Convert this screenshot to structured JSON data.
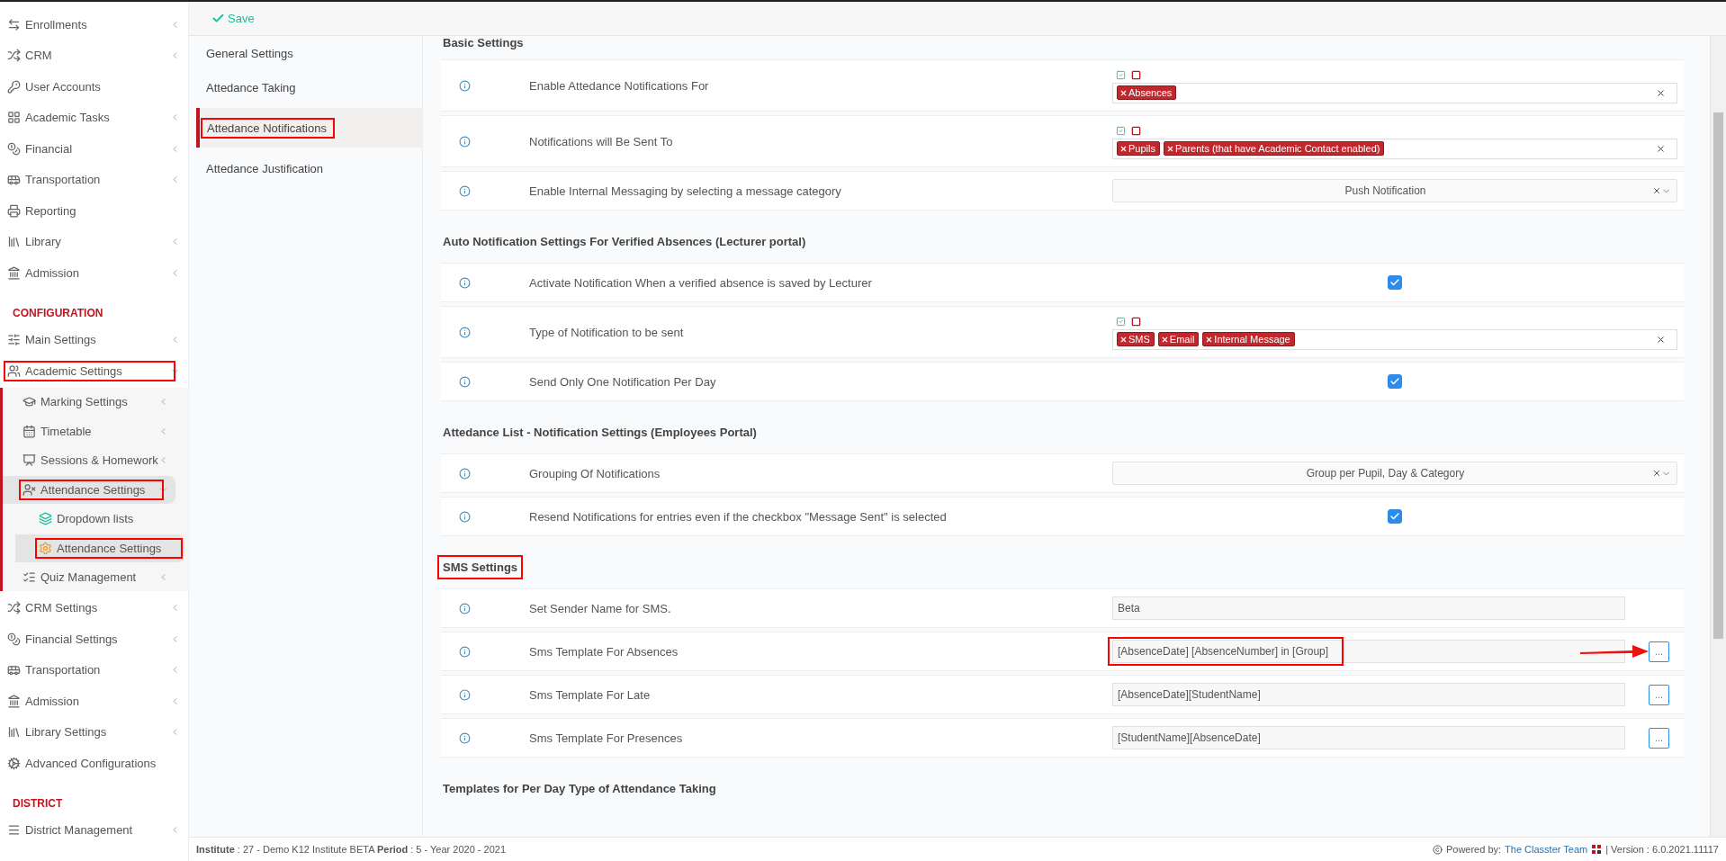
{
  "header": {
    "save_label": "Save"
  },
  "sidebar": {
    "groups": [
      {
        "items": [
          {
            "label": "Enrollments",
            "selected": false,
            "annotated": false,
            "expanded": false
          },
          {
            "label": "CRM",
            "selected": false,
            "annotated": false,
            "expanded": false
          },
          {
            "label": "User Accounts",
            "selected": false,
            "annotated": false
          },
          {
            "label": "Academic Tasks",
            "selected": false,
            "annotated": false,
            "expanded": false
          },
          {
            "label": "Financial",
            "selected": false,
            "annotated": false,
            "expanded": false
          },
          {
            "label": "Transportation",
            "selected": false,
            "annotated": false,
            "expanded": false
          },
          {
            "label": "Reporting",
            "selected": false,
            "annotated": false
          },
          {
            "label": "Library",
            "selected": false,
            "annotated": false,
            "expanded": false
          },
          {
            "label": "Admission",
            "selected": false,
            "annotated": false,
            "expanded": false
          }
        ]
      },
      {
        "heading": "CONFIGURATION",
        "items": [
          {
            "label": "Main Settings",
            "selected": false,
            "annotated": false,
            "expanded": false
          },
          {
            "label": "Academic Settings",
            "selected": false,
            "annotated": true,
            "expanded": true,
            "children": [
              {
                "label": "Marking Settings",
                "selected": false,
                "annotated": false,
                "expanded": false
              },
              {
                "label": "Timetable",
                "selected": false,
                "annotated": false,
                "expanded": false
              },
              {
                "label": "Sessions & Homework",
                "selected": false,
                "annotated": false,
                "expanded": false
              },
              {
                "label": "Attendance Settings",
                "selected": true,
                "annotated": true,
                "expanded": true,
                "children": [
                  {
                    "label": "Dropdown lists",
                    "selected": false,
                    "annotated": false
                  },
                  {
                    "label": "Attendance Settings",
                    "selected": true,
                    "annotated": true
                  }
                ]
              },
              {
                "label": "Quiz Management",
                "selected": false,
                "annotated": false,
                "expanded": false
              }
            ]
          },
          {
            "label": "CRM Settings",
            "selected": false,
            "annotated": false,
            "expanded": false
          },
          {
            "label": "Financial Settings",
            "selected": false,
            "annotated": false,
            "expanded": false
          },
          {
            "label": "Transportation",
            "selected": false,
            "annotated": false,
            "expanded": false
          },
          {
            "label": "Admission",
            "selected": false,
            "annotated": false,
            "expanded": false
          },
          {
            "label": "Library Settings",
            "selected": false,
            "annotated": false,
            "expanded": false
          },
          {
            "label": "Advanced Configurations",
            "selected": false,
            "annotated": false
          }
        ]
      },
      {
        "heading": "DISTRICT",
        "items": [
          {
            "label": "District Management",
            "selected": false,
            "annotated": false,
            "expanded": false
          }
        ]
      }
    ]
  },
  "tabs": [
    {
      "label": "General Settings",
      "selected": false,
      "annotated": false
    },
    {
      "label": "Attedance Taking",
      "selected": false,
      "annotated": false
    },
    {
      "label": "Attedance Notifications",
      "selected": true,
      "annotated": true
    },
    {
      "label": "Attedance Justification",
      "selected": false,
      "annotated": false
    }
  ],
  "sections": [
    {
      "title": "Basic Settings",
      "rows": [
        {
          "kind": "tags",
          "label": "Enable Attedance Notifications For",
          "tags": [
            "Absences"
          ]
        },
        {
          "kind": "tags",
          "label": "Notifications will Be Sent To",
          "tags": [
            "Pupils",
            "Parents (that have Academic Contact enabled)"
          ]
        },
        {
          "kind": "select",
          "label": "Enable Internal Messaging by selecting a message category",
          "value": "Push Notification"
        }
      ]
    },
    {
      "title": "Auto Notification Settings For Verified Absences (Lecturer portal)",
      "rows": [
        {
          "kind": "checkbox",
          "label": "Activate Notification When a verified absence is saved by Lecturer",
          "checked": true
        },
        {
          "kind": "tags",
          "label": "Type of Notification to be sent",
          "tags": [
            "SMS",
            "Email",
            "Internal Message"
          ]
        },
        {
          "kind": "checkbox",
          "label": "Send Only One Notification Per Day",
          "checked": true
        }
      ]
    },
    {
      "title": "Attedance List - Notification Settings (Employees Portal)",
      "rows": [
        {
          "kind": "select",
          "label": "Grouping Of Notifications",
          "value": "Group per Pupil, Day & Category"
        },
        {
          "kind": "checkbox",
          "label": "Resend Notifications for entries even if the checkbox \"Message Sent\" is selected",
          "checked": true
        }
      ]
    },
    {
      "title": "SMS Settings",
      "annotated": true,
      "rows": [
        {
          "kind": "text",
          "label": "Set Sender Name for SMS.",
          "value": "Beta"
        },
        {
          "kind": "template",
          "label": "Sms Template For Absences",
          "value": "[AbsenceDate] [AbsenceNumber] in [Group]",
          "button": "...",
          "annotated": true,
          "arrow": true
        },
        {
          "kind": "template",
          "label": "Sms Template For Late",
          "value": "[AbsenceDate][StudentName]",
          "button": "..."
        },
        {
          "kind": "template",
          "label": "Sms Template For Presences",
          "value": "[StudentName][AbsenceDate]",
          "button": "..."
        }
      ]
    },
    {
      "title": "Templates for Per Day Type of Attendance Taking"
    }
  ],
  "footer": {
    "info": "**Institute** : 27 - Demo K12 Institute BETA **Period** : 5 - Year 2020 - 2021",
    "powered": "Powered by:",
    "link": "The Classter Team",
    "version": "| Version : 6.0.2021.11117"
  }
}
